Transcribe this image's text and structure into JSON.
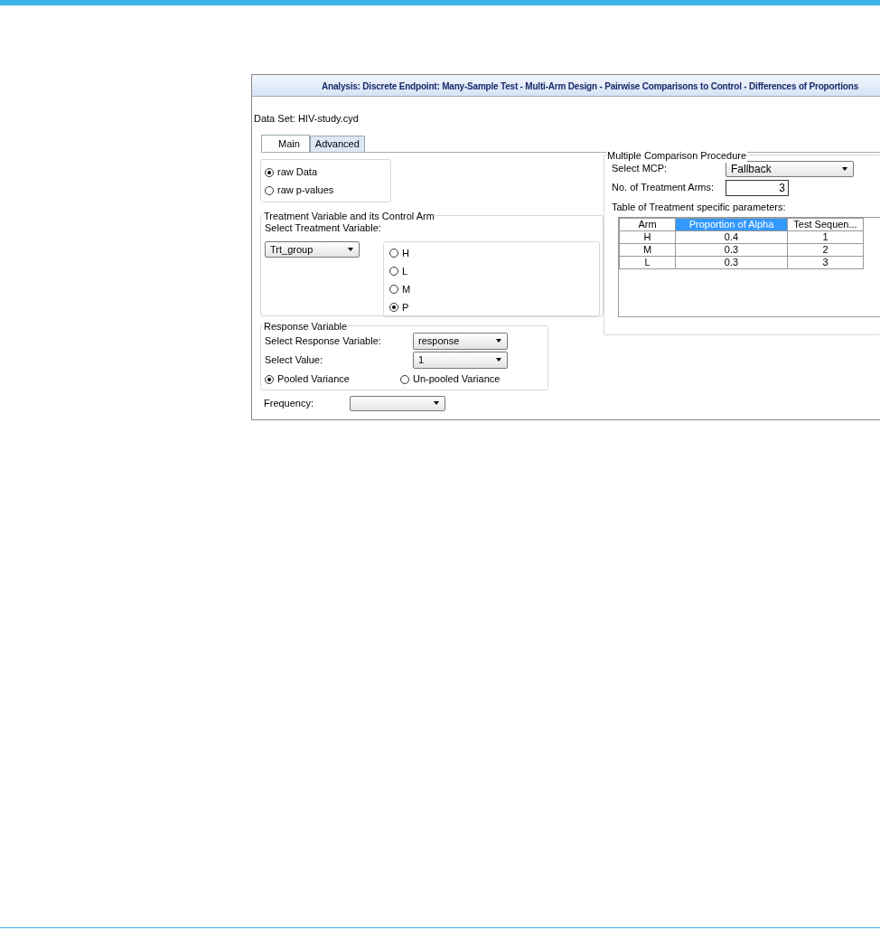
{
  "window": {
    "title": "Analysis: Discrete Endpoint: Many-Sample Test - Multi-Arm Design - Pairwise Comparisons to Control - Differences of Proportions"
  },
  "data_set": "Data Set: HIV-study.cyd",
  "tabs": [
    {
      "label": "Main",
      "selected": true
    },
    {
      "label": "Advanced",
      "selected": false
    }
  ],
  "data_source": [
    {
      "label": "raw Data",
      "selected": true
    },
    {
      "label": "raw p-values",
      "selected": false
    }
  ],
  "treatment": {
    "title": "Treatment Variable and its Control Arm",
    "label": "Select Treatment Variable:",
    "value": "Trt_group",
    "control_arms": [
      {
        "label": "H",
        "selected": false
      },
      {
        "label": "L",
        "selected": false
      },
      {
        "label": "M",
        "selected": false
      },
      {
        "label": "P",
        "selected": true
      }
    ]
  },
  "response": {
    "title": "Response Variable",
    "variable_label": "Select Response Variable:",
    "variable": "response",
    "value_label": "Select Value:",
    "value": "1",
    "variance": [
      {
        "label": "Pooled Variance",
        "selected": true
      },
      {
        "label": "Un-pooled Variance",
        "selected": false
      }
    ]
  },
  "frequency": {
    "label": "Frequency:"
  },
  "mcp": {
    "title": "Multiple Comparison Procedure",
    "select_label": "Select MCP:",
    "value": "Fallback",
    "arms_label": "No. of Treatment Arms:",
    "arms": "3",
    "table_label": "Table of Treatment specific parameters:",
    "columns": [
      {
        "label": "Arm",
        "selected": false
      },
      {
        "label": "Proportion of Alpha",
        "selected": true
      },
      {
        "label": "Test Sequen...",
        "selected": false
      }
    ],
    "rows": [
      [
        "H",
        "0.4",
        "1"
      ],
      [
        "M",
        "0.3",
        "2"
      ],
      [
        "L",
        "0.3",
        "3"
      ]
    ]
  }
}
